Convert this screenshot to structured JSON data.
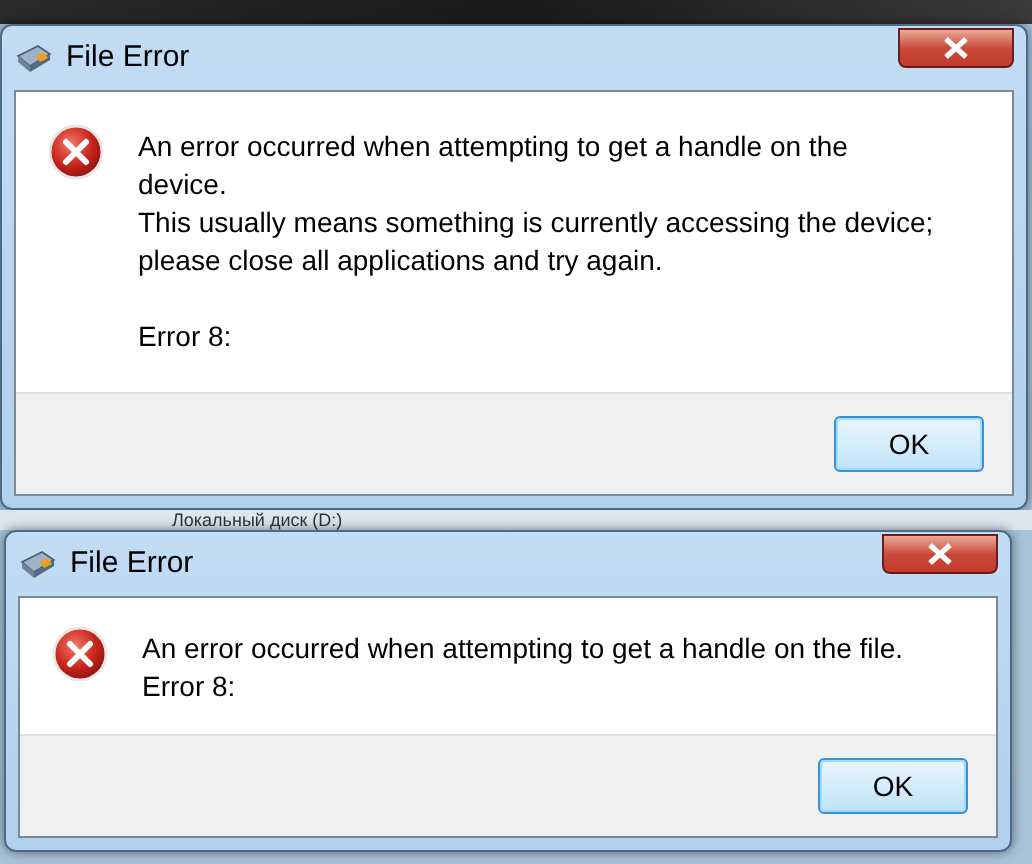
{
  "background": {
    "label": "Локальный диск (D:)"
  },
  "dialogs": [
    {
      "title": "File Error",
      "kind": "error",
      "message": "An error occurred when attempting to get a handle on the device.\nThis usually means something is currently accessing the device; please close all applications and try again.\n\nError 8:",
      "button": "OK"
    },
    {
      "title": "File Error",
      "kind": "error",
      "message": "An error occurred when attempting to get a handle on the file.\nError 8:",
      "button": "OK"
    }
  ]
}
